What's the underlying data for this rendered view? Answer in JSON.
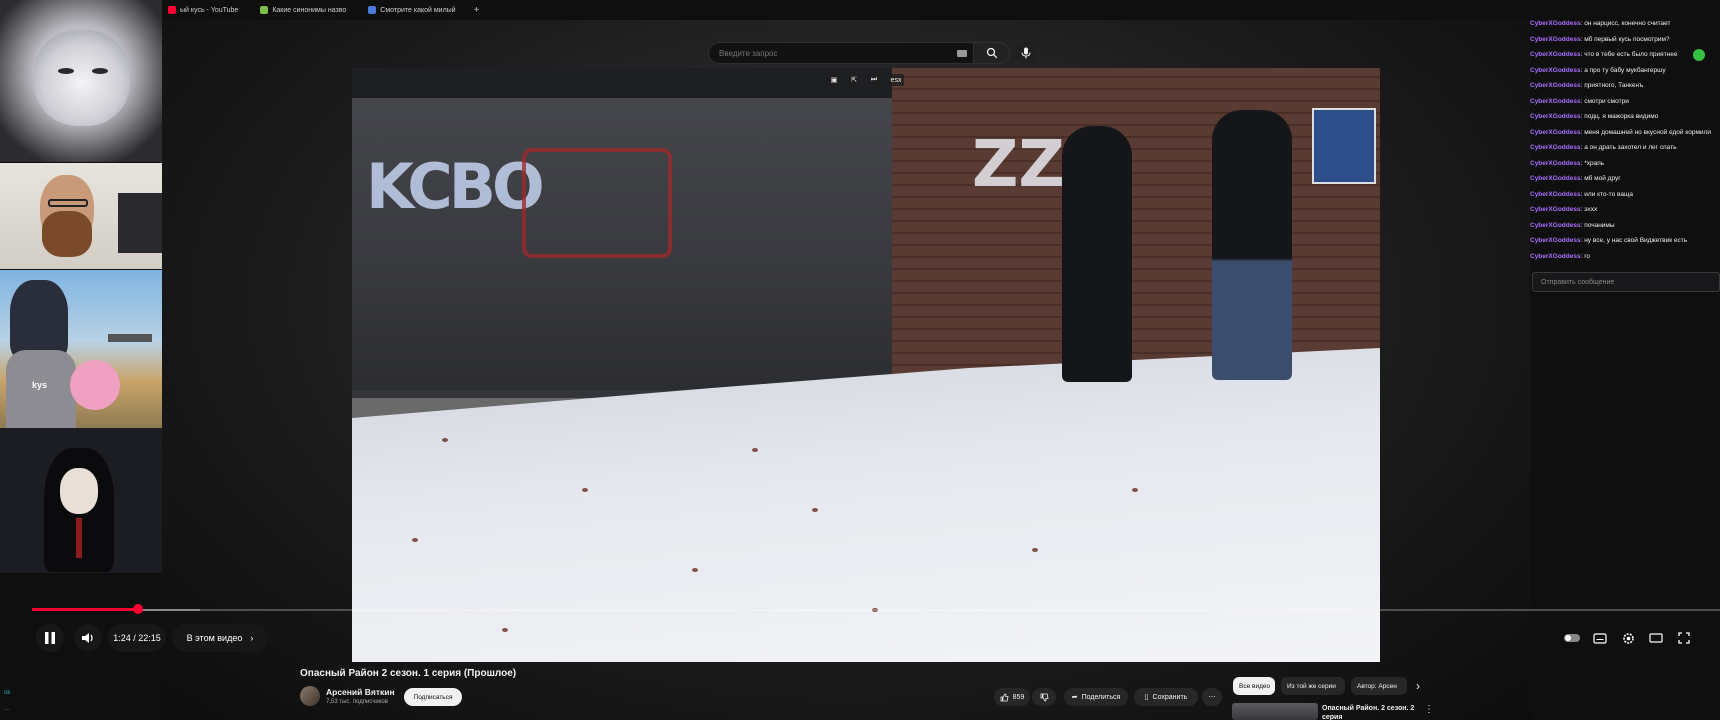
{
  "tabs": [
    {
      "label": "ый кусь - YouTube",
      "color": "#ff0033"
    },
    {
      "label": "Какие синонимы назво",
      "color": "#7bbf4a"
    },
    {
      "label": "Смотрите какой милый",
      "color": "#4a7bd8"
    }
  ],
  "search": {
    "placeholder": "Введите запрос"
  },
  "player": {
    "time": "1:24 / 22:15",
    "chapter": "В этом видео",
    "progress_fraction": 0.063,
    "overlay_label": "esx"
  },
  "video_graffiti": [
    "KCBO",
    "ZZ"
  ],
  "video": {
    "title": "Опасный Район 2 сезон. 1 серия (Прошлое)",
    "channel": "Арсений Вяткин",
    "subscribers": "7,53 тыс. подписчиков",
    "subscribe_label": "Подписаться",
    "likes": "859",
    "share_label": "Поделиться",
    "save_label": "Сохранить"
  },
  "chips": [
    {
      "label": "Все видео",
      "active": true
    },
    {
      "label": "Из той же серии",
      "active": false
    },
    {
      "label": "Автор: Арсен",
      "active": false
    }
  ],
  "recommendation": {
    "title": "Опасный Район. 2 сезон. 2 серия"
  },
  "cam_labels": {
    "cam3_shirt": "kys"
  },
  "chat": {
    "messages": [
      {
        "user": "CyberXGoddess",
        "text": "он нарцисс, конечно считает"
      },
      {
        "user": "CyberXGoddess",
        "text": "мб первый кусь посмотрим?"
      },
      {
        "user": "CyberXGoddess",
        "text": "что в тебе есть было приятнее"
      },
      {
        "user": "CyberXGoddess",
        "text": "а про ту бабу мукбангершу"
      },
      {
        "user": "CyberXGoddess",
        "text": "приятного, Танкенъ"
      },
      {
        "user": "CyberXGoddess",
        "text": "смотри смотри"
      },
      {
        "user": "CyberXGoddess",
        "text": "подц. я мажорка видимо"
      },
      {
        "user": "CyberXGoddess",
        "text": "меня домашней но вкусной едой кормили"
      },
      {
        "user": "CyberXGoddess",
        "text": "а он драть захотел и лег спать"
      },
      {
        "user": "CyberXGoddess",
        "text": "*храпь"
      },
      {
        "user": "CyberXGoddess",
        "text": "мб мой друг"
      },
      {
        "user": "CyberXGoddess",
        "text": "или кто-то ваща"
      },
      {
        "user": "CyberXGoddess",
        "text": "эххх"
      },
      {
        "user": "CyberXGoddess",
        "text": "почанимы"
      },
      {
        "user": "CyberXGoddess",
        "text": "ну все, у нас свой Виджетвик есть"
      },
      {
        "user": "CyberXGoddess",
        "text": "го"
      }
    ],
    "input_placeholder": "Отправить сообщение"
  },
  "left_edge": [
    "ok",
    "..."
  ],
  "colors": {
    "accent": "#ff0033",
    "chat_user": "#a970ff",
    "background": "#0f0f0f"
  }
}
